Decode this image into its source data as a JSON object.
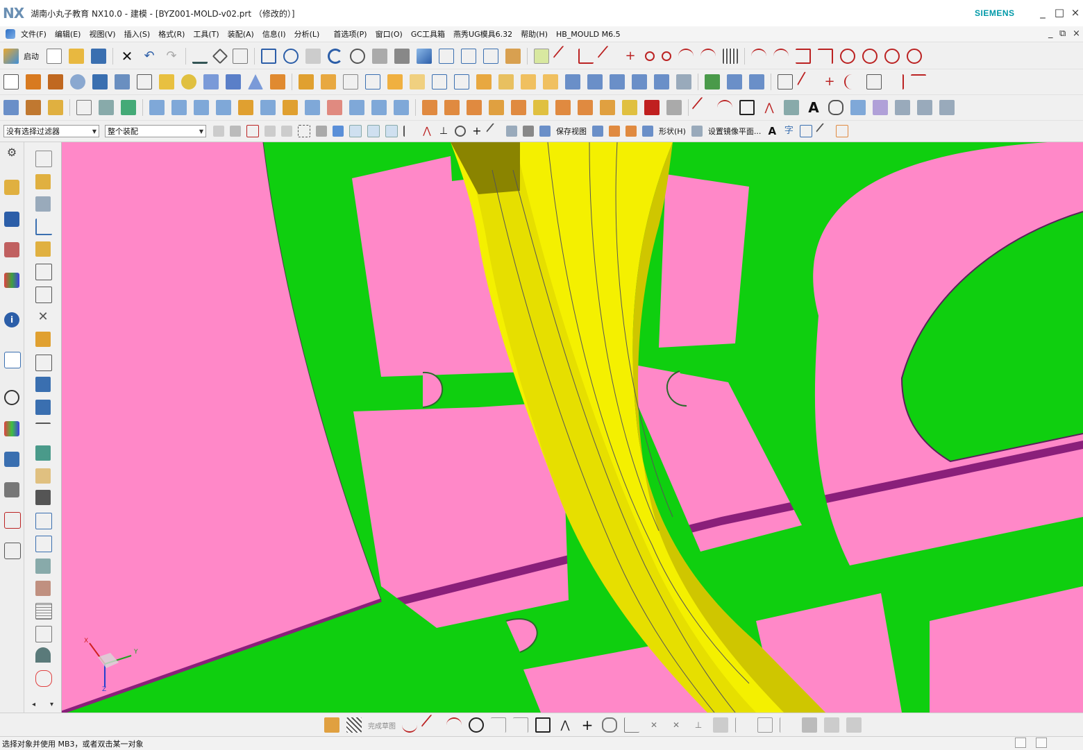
{
  "window": {
    "logo": "NX",
    "title": "湖南小丸子教育 NX10.0 - 建模 - [BYZ001-MOLD-v02.prt （修改的）]",
    "brand": "SIEMENS",
    "controls": [
      "_",
      "□",
      "×"
    ]
  },
  "menubar": {
    "items": [
      "文件(F)",
      "编辑(E)",
      "视图(V)",
      "插入(S)",
      "格式(R)",
      "工具(T)",
      "装配(A)",
      "信息(I)",
      "分析(L)",
      "首选项(P)",
      "窗口(O)",
      "GC工具箱",
      "燕秀UG模具6.32",
      "帮助(H)",
      "HB_MOULD M6.5"
    ],
    "controls": [
      "_",
      "⧉",
      "×"
    ]
  },
  "toolbar1": {
    "start_label": "启动"
  },
  "filterbar": {
    "selection_filter": "没有选择过滤器",
    "assembly_scope": "整个装配",
    "save_view_label": "保存视图",
    "shape_label": "形状(H)",
    "mirror_plane_label": "设置镜像平面..."
  },
  "bottombar": {
    "finish_sketch_label": "完成草图"
  },
  "status": {
    "message": "选择对象并使用 MB3，或者双击某一对象"
  },
  "triad": {
    "x": "X",
    "y": "Y",
    "z": "Z"
  },
  "colors": {
    "viewport_background": "#ff88c8",
    "mold_plate": "#0fcf0f",
    "plate_edge": "#8a1f7a",
    "part_body": "#f4f000",
    "part_shadow": "#cfc600",
    "brand": "#0099a8"
  },
  "icons": [
    "nx-logo",
    "undo-icon",
    "redo-icon",
    "save-icon",
    "open-icon",
    "new-file-icon",
    "fit-view-icon",
    "zoom-icon",
    "rotate-icon",
    "sketch-line-icon",
    "arc-icon",
    "circle-icon",
    "rectangle-icon",
    "text-icon",
    "clock-icon",
    "info-icon",
    "settings-icon"
  ]
}
